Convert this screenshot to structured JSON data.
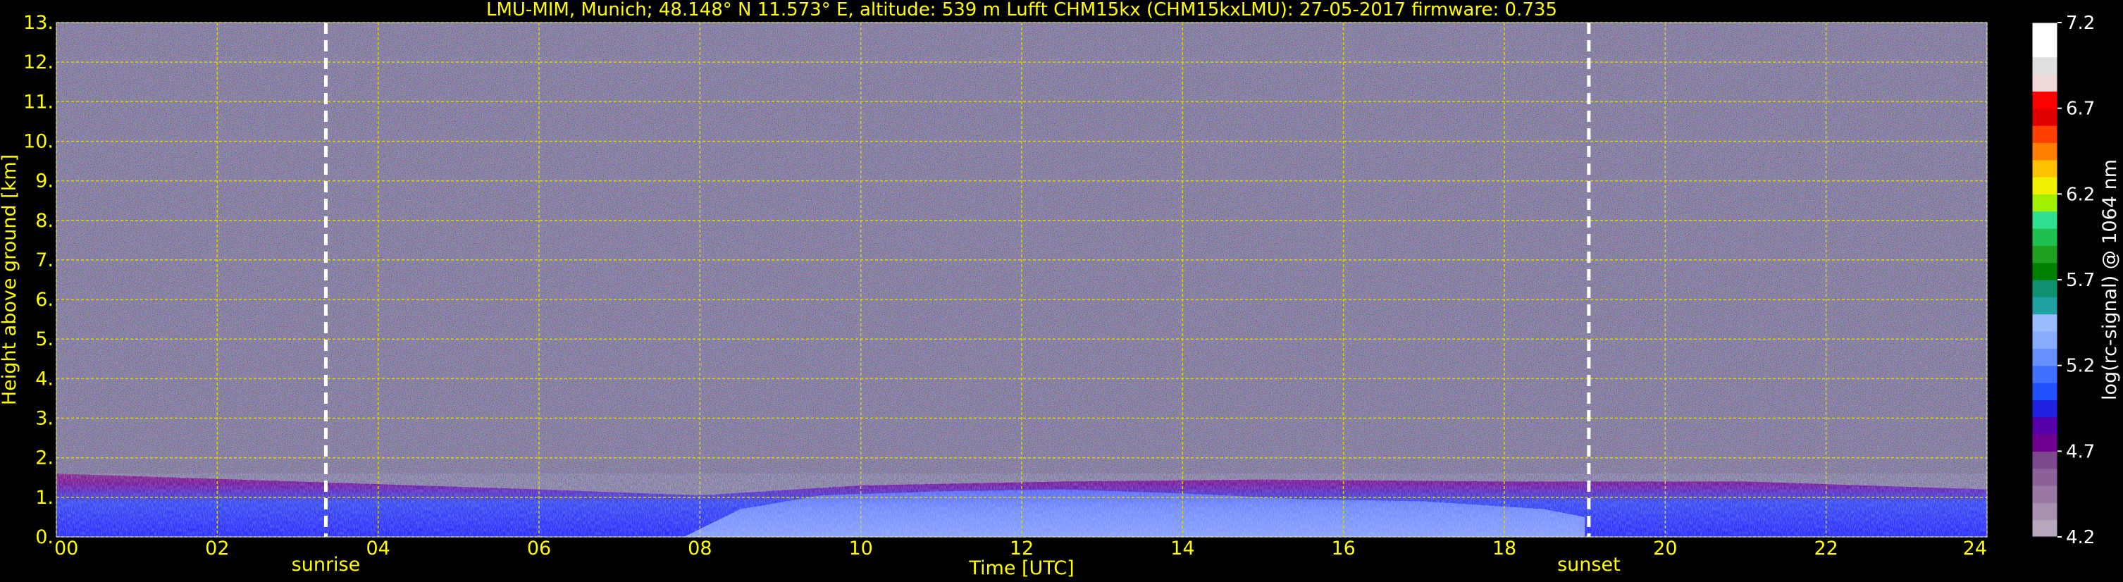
{
  "chart_data": {
    "type": "heatmap",
    "title": "LMU-MIM, Munich; 48.148° N 11.573° E, altitude: 539 m    Lufft CHM15kx (CHM15kxLMU): 27-05-2017    firmware: 0.735",
    "xlabel": "Time [UTC]",
    "ylabel": "Height above ground [km]",
    "xlim": [
      0,
      24
    ],
    "ylim": [
      0,
      13
    ],
    "x_ticks": [
      "00",
      "02",
      "04",
      "06",
      "08",
      "10",
      "12",
      "14",
      "16",
      "18",
      "20",
      "22",
      "24"
    ],
    "y_ticks": [
      "0.",
      "1.",
      "2.",
      "3.",
      "4.",
      "5.",
      "6.",
      "7.",
      "8.",
      "9.",
      "10.",
      "11.",
      "12.",
      "13."
    ],
    "grid": true,
    "markers": [
      {
        "label": "sunrise",
        "time_utc": 3.35
      },
      {
        "label": "sunset",
        "time_utc": 19.05
      }
    ],
    "colorbar": {
      "label": "log(rc-signal) @ 1064 nm",
      "range": [
        4.2,
        7.2
      ],
      "ticks": [
        "4.2",
        "4.7",
        "5.2",
        "5.7",
        "6.2",
        "6.7",
        "7.2"
      ],
      "colors": [
        "#b8a8bd",
        "#a890b0",
        "#9a78a4",
        "#8c6098",
        "#7e488c",
        "#700090",
        "#5500a8",
        "#2020e0",
        "#2050ff",
        "#4070ff",
        "#6690ff",
        "#88aaff",
        "#99bbff",
        "#20a0a0",
        "#109070",
        "#008000",
        "#20a020",
        "#20c050",
        "#30e090",
        "#a0f000",
        "#f0f000",
        "#ffc000",
        "#ff8000",
        "#ff4000",
        "#e00000",
        "#ff0000",
        "#f0d8d8",
        "#e0e0e0",
        "#ffffff",
        "#ffffff"
      ]
    },
    "boundary_layer_top_km": [
      {
        "time_utc": 0,
        "height_km": 1.6
      },
      {
        "time_utc": 3,
        "height_km": 1.4
      },
      {
        "time_utc": 6,
        "height_km": 1.2
      },
      {
        "time_utc": 8,
        "height_km": 1.05
      },
      {
        "time_utc": 10,
        "height_km": 1.3
      },
      {
        "time_utc": 12.5,
        "height_km": 1.4
      },
      {
        "time_utc": 15,
        "height_km": 1.45
      },
      {
        "time_utc": 18,
        "height_km": 1.4
      },
      {
        "time_utc": 21,
        "height_km": 1.4
      },
      {
        "time_utc": 24,
        "height_km": 1.2
      }
    ]
  }
}
